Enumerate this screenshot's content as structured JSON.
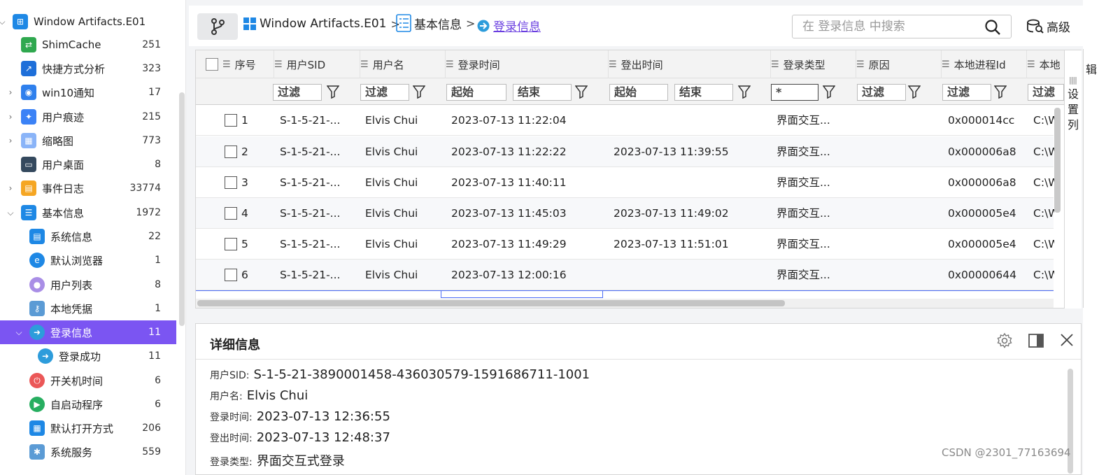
{
  "sidebar": {
    "items": [
      {
        "label": "Window Artifacts.E01",
        "count": "",
        "caret": "⌵",
        "icon": "windows-icon",
        "color": "#1e88e5"
      },
      {
        "label": "ShimCache",
        "count": "251",
        "caret": "",
        "icon": "shimcache-icon",
        "color": "#2fa84f"
      },
      {
        "label": "快捷方式分析",
        "count": "323",
        "caret": "",
        "icon": "shortcut-icon",
        "color": "#1e6fd9"
      },
      {
        "label": "win10通知",
        "count": "17",
        "caret": "›",
        "icon": "bell-icon",
        "color": "#2f80ed"
      },
      {
        "label": "用户痕迹",
        "count": "215",
        "caret": "›",
        "icon": "footprint-icon",
        "color": "#3b82f6"
      },
      {
        "label": "缩略图",
        "count": "773",
        "caret": "›",
        "icon": "thumbnail-icon",
        "color": "#8ab4f8"
      },
      {
        "label": "用户桌面",
        "count": "8",
        "caret": "",
        "icon": "desktop-icon",
        "color": "#34495e"
      },
      {
        "label": "事件日志",
        "count": "33774",
        "caret": "›",
        "icon": "event-log-icon",
        "color": "#f5a623"
      },
      {
        "label": "基本信息",
        "count": "1972",
        "caret": "⌵",
        "icon": "list-icon",
        "color": "#1e88e5"
      },
      {
        "label": "系统信息",
        "count": "22",
        "caret": "",
        "icon": "system-info-icon",
        "color": "#1e88e5"
      },
      {
        "label": "默认浏览器",
        "count": "1",
        "caret": "",
        "icon": "browser-icon",
        "color": "#1e88e5"
      },
      {
        "label": "用户列表",
        "count": "8",
        "caret": "",
        "icon": "user-icon",
        "color": "#a98ee6"
      },
      {
        "label": "本地凭据",
        "count": "1",
        "caret": "",
        "icon": "key-icon",
        "color": "#5b9bd5"
      },
      {
        "label": "登录信息",
        "count": "11",
        "caret": "⌵",
        "icon": "login-icon",
        "color": "#2d9cdb"
      },
      {
        "label": "登录成功",
        "count": "11",
        "caret": "",
        "icon": "login-success-icon",
        "color": "#2d9cdb"
      },
      {
        "label": "开关机时间",
        "count": "6",
        "caret": "",
        "icon": "power-icon",
        "color": "#eb5757"
      },
      {
        "label": "自启动程序",
        "count": "6",
        "caret": "",
        "icon": "play-icon",
        "color": "#27ae60"
      },
      {
        "label": "默认打开方式",
        "count": "206",
        "caret": "",
        "icon": "apps-icon",
        "color": "#1e88e5"
      },
      {
        "label": "系统服务",
        "count": "559",
        "caret": "",
        "icon": "service-icon",
        "color": "#5b9bd5"
      }
    ]
  },
  "breadcrumb": {
    "items": [
      "Window Artifacts.E01",
      "基本信息",
      "登录信息"
    ],
    "separator": ">"
  },
  "search": {
    "placeholder": "在 登录信息 中搜索"
  },
  "advanced_label": "高级",
  "table": {
    "columns": [
      "序号",
      "用户SID",
      "用户名",
      "登录时间",
      "登出时间",
      "登录类型",
      "原因",
      "本地进程Id",
      "本地"
    ],
    "filters": {
      "filter_label": "过滤",
      "start_label": "起始",
      "end_label": "结束",
      "login_type_value": "*"
    },
    "rows": [
      {
        "no": "1",
        "sid": "S-1-5-21-...",
        "user": "Elvis Chui",
        "login": "2023-07-13 11:22:04",
        "logout": "",
        "type": "界面交互...",
        "reason": "",
        "pid": "0x000014cc",
        "path": "C:\\W"
      },
      {
        "no": "2",
        "sid": "S-1-5-21-...",
        "user": "Elvis Chui",
        "login": "2023-07-13 11:22:22",
        "logout": "2023-07-13 11:39:55",
        "type": "界面交互...",
        "reason": "",
        "pid": "0x000006a8",
        "path": "C:\\W"
      },
      {
        "no": "3",
        "sid": "S-1-5-21-...",
        "user": "Elvis Chui",
        "login": "2023-07-13 11:40:11",
        "logout": "",
        "type": "界面交互...",
        "reason": "",
        "pid": "0x000006a8",
        "path": "C:\\W"
      },
      {
        "no": "4",
        "sid": "S-1-5-21-...",
        "user": "Elvis Chui",
        "login": "2023-07-13 11:45:03",
        "logout": "2023-07-13 11:49:02",
        "type": "界面交互...",
        "reason": "",
        "pid": "0x000005e4",
        "path": "C:\\W"
      },
      {
        "no": "5",
        "sid": "S-1-5-21-...",
        "user": "Elvis Chui",
        "login": "2023-07-13 11:49:29",
        "logout": "2023-07-13 11:51:01",
        "type": "界面交互...",
        "reason": "",
        "pid": "0x000005e4",
        "path": "C:\\W"
      },
      {
        "no": "6",
        "sid": "S-1-5-21-...",
        "user": "Elvis Chui",
        "login": "2023-07-13 12:00:16",
        "logout": "",
        "type": "界面交互...",
        "reason": "",
        "pid": "0x00000644",
        "path": "C:\\W"
      }
    ],
    "settings_column_label": "设置列"
  },
  "detail": {
    "title": "详细信息",
    "fields": [
      {
        "key": "用户SID:",
        "value": "S-1-5-21-3890001458-436030579-1591686711-1001"
      },
      {
        "key": "用户名:",
        "value": "Elvis Chui"
      },
      {
        "key": "登录时间:",
        "value": "2023-07-13 12:36:55"
      },
      {
        "key": "登出时间:",
        "value": "2023-07-13 12:48:37"
      },
      {
        "key": "登录类型:",
        "value": "界面交互式登录"
      }
    ]
  },
  "right_strip_text": "辑",
  "watermark": "CSDN @2301_77163694",
  "colors": {
    "accent": "#7b55f2",
    "link": "#6a3fe0",
    "selection": "#4a6cf7"
  }
}
